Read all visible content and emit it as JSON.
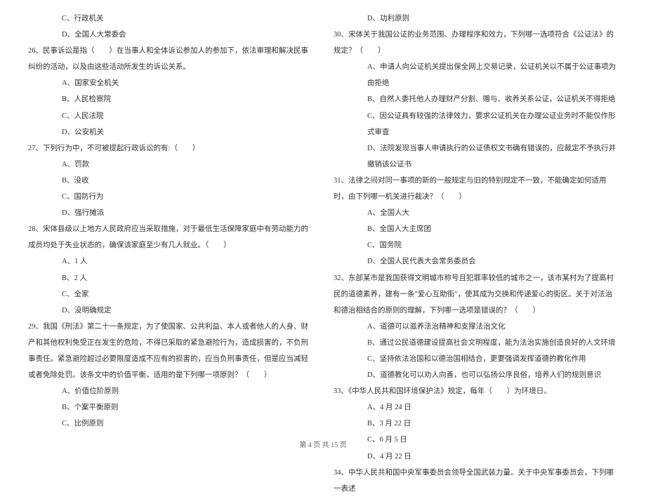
{
  "left": {
    "q25": {
      "optC": "C、行政机关",
      "optD": "D、全国人大常委会"
    },
    "q26": {
      "text": "26、民事诉讼是指（　　）在当事人和全体诉讼参加人的参加下，依法审理和解决民事纠纷的活动，以及由这些活动所发生的诉讼关系。",
      "optA": "A、国家安全机关",
      "optB": "B、人民检察院",
      "optC": "C、人民法院",
      "optD": "D、公安机关"
    },
    "q27": {
      "text": "27、下列行为中，不可被提起行政诉讼的有:（　　）",
      "optA": "A、罚款",
      "optB": "B、没收",
      "optC": "C、国防行为",
      "optD": "D、强行摊派"
    },
    "q28": {
      "text": "28、宋体县级以上地方人民政府应当采取措施，对于最低生活保障家庭中有劳动能力的成员均处于失业状态的，确保该家庭至少有几人就业。（　　）",
      "optA": "A、1 人",
      "optB": "B、2 人",
      "optC": "C、全家",
      "optD": "D、没明确规定"
    },
    "q29": {
      "text": "29、我国《刑法》第二十一条规定，为了使国家、公共利益、本人或者他人的人身、财产和其他权利免受正在发生的危险，不得已采取的紧急避险行为，造成损害的，不负刑事责任。紧急避险超过必要限度造成不应有的损害的，应当负刑事责任，但是应当减轻或者免除处罚。该条文中的价值平衡，适用的是下列哪一项原则？（　　）",
      "optA": "A、价值位阶原则",
      "optB": "B、个案平衡原则",
      "optC": "C、比例原则"
    }
  },
  "right": {
    "q29": {
      "optD": "D、功利原则"
    },
    "q30": {
      "text": "30、宋体关于我国公证的业务范围、办理程序和效力，下列哪一选项符合《公证法》的规定？（　　）",
      "optA": "A、申请人向公证机关提出保全网上交易记录，公证机关以不属于公证事项为由拒绝",
      "optB": "B、自然人委托他人办理财产分割、赠与、收养关系公证，公证机关不得拒绝",
      "optC": "C、因公证具有较强的法律效力，要求公证机关在办理公证业务时不能仅作形式审查",
      "optD": "D、法院发现当事人申请执行的公证债权文书确有错误的，应裁定不予执行并撤销该公证书"
    },
    "q31": {
      "text": "31、法律之间对同一事项的新的一般规定与旧的特别规定不一致，不能确定如何适用时，由下列哪一机关进行裁决？（　　）",
      "optA": "A、全国人大",
      "optB": "B、全国人大主席团",
      "optC": "C、国务院",
      "optD": "D、全国人民代表大会常务委员会"
    },
    "q32": {
      "text": "32、东部某市是我国获得文明城市称号且犯罪率较低的城市之一，该市某村为了提高村民的道德素养，建有一条\"爱心互助街\"，使其成为交换和传递爱心的街区。关于对法治和德治相结合的原则的理解，下列哪一选项是错误的？（　　）",
      "optA": "A、道德可以滋养法治精神和支撑法治文化",
      "optB": "B、通过公民道德建设提高社会文明程度，能为法治实施创造良好的人文环境",
      "optC": "C、坚持依法治国和以德治国相结合，更要强调发挥道德的教化作用",
      "optD": "D、道德教化可以劝人向善，也可以弘扬公序良俗，培养人们的规则意识"
    },
    "q33": {
      "text": "33、《中华人民共和国环境保护法》规定，每年（　　）为环境日。",
      "optA": "A、4 月 24 日",
      "optB": "B、3 月 22 日",
      "optC": "C、6 月 5 日",
      "optD": "D、4 月 22 日"
    },
    "q34": {
      "text": "34、中华人民共和国中央军事委员会领导全国武装力量。关于中央军事委员会，下列哪一表述"
    }
  },
  "footer": "第 4 页  共 15 页"
}
